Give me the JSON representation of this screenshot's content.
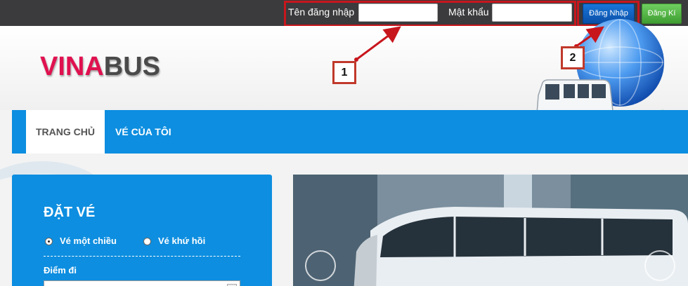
{
  "topbar": {
    "username_label": "Tên đăng nhập",
    "username_value": "",
    "password_label": "Mật khẩu",
    "password_value": "",
    "login_button": "Đăng Nhập",
    "register_button": "Đăng Kí"
  },
  "logo": {
    "part1": "VINA",
    "part2": "BUS"
  },
  "annotations": {
    "callout1": "1",
    "callout2": "2"
  },
  "nav": {
    "home": "TRANG CHỦ",
    "my_tickets": "VÉ CỦA TÔI"
  },
  "booking": {
    "title": "ĐẶT VÉ",
    "one_way": "Vé một chiều",
    "round_trip": "Vé khứ hồi",
    "departure_label": "Điểm đi",
    "departure_value": ""
  },
  "colors": {
    "topbar": "#3b3a3c",
    "nav": "#0d8ee0",
    "logo_red": "#e0114f",
    "logo_gray": "#4a4a4a",
    "annotation": "#c8161d",
    "login_blue": "#0a4fa8",
    "register_green": "#3f9d31"
  }
}
